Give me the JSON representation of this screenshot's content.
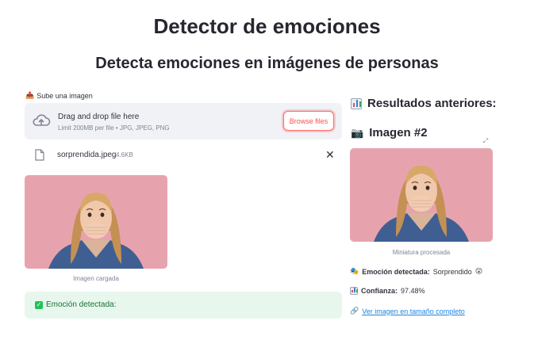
{
  "header": {
    "title": "Detector de emociones",
    "subtitle": "Detecta emociones en imágenes de personas"
  },
  "uploader": {
    "label": "Sube una imagen",
    "drop_text": "Drag and drop file here",
    "limit_text": "Limit 200MB per file • JPG, JPEG, PNG",
    "browse_label": "Browse files",
    "file_name": "sorprendida.jpeg",
    "file_size": "4.6KB"
  },
  "left": {
    "image_caption": "Imagen cargada",
    "alert_text": "Emoción detectada:"
  },
  "right": {
    "section_title": "Resultados anteriores:",
    "image_title": "Imagen #2",
    "image_caption": "Miniatura procesada",
    "emotion_label": "Emoción detectada:",
    "emotion_value": "Sorprendido",
    "confidence_label": "Confianza:",
    "confidence_value": "97.48%",
    "link_text": "Ver imagen en tamaño completo"
  },
  "colors": {
    "accent": "#ff4b4b",
    "success_bg": "#e8f7ee",
    "success_text": "#177233",
    "link": "#1c83e1",
    "photo_bg": "#e7a3ad"
  }
}
